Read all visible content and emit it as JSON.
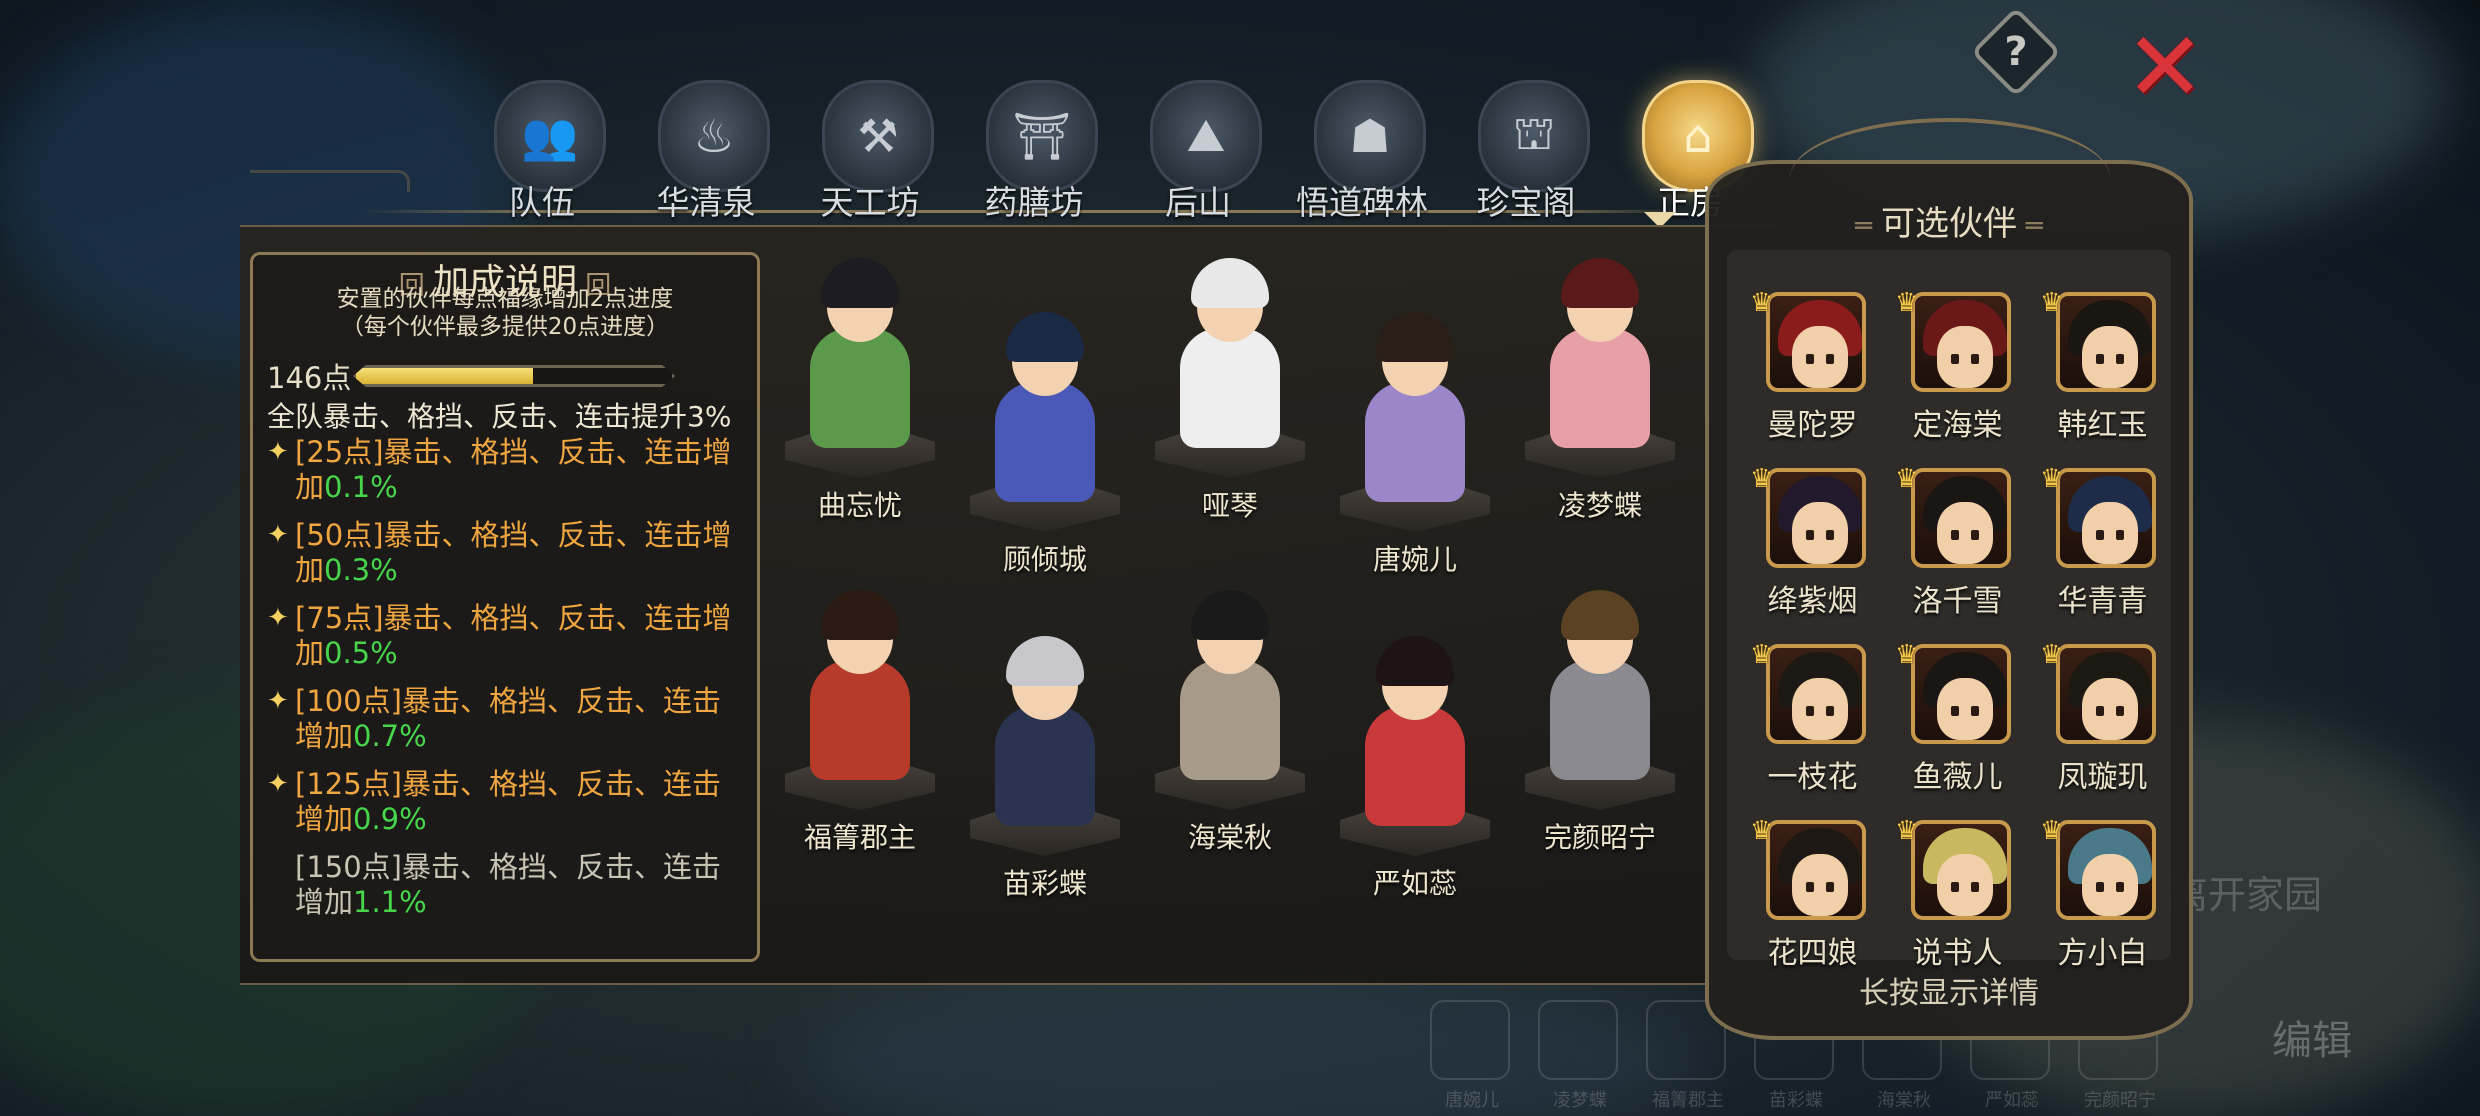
{
  "nav": {
    "tabs": [
      {
        "label": "队伍",
        "icon": "team-icon",
        "glyph": "👥",
        "active": false
      },
      {
        "label": "华清泉",
        "icon": "hot-spring-icon",
        "glyph": "♨",
        "active": false
      },
      {
        "label": "天工坊",
        "icon": "workshop-icon",
        "glyph": "⚒",
        "active": false
      },
      {
        "label": "药膳坊",
        "icon": "kitchen-icon",
        "glyph": "⛩",
        "active": false
      },
      {
        "label": "后山",
        "icon": "mountain-icon",
        "glyph": "⛰",
        "active": false
      },
      {
        "label": "悟道碑林",
        "icon": "stele-icon",
        "glyph": "☗",
        "active": false
      },
      {
        "label": "珍宝阁",
        "icon": "pagoda-icon",
        "glyph": "⛫",
        "active": false
      },
      {
        "label": "正房",
        "icon": "main-house-icon",
        "glyph": "⌂",
        "active": true
      }
    ]
  },
  "top_buttons": {
    "help_glyph": "?",
    "close_glyph": "✕"
  },
  "bonus": {
    "title": "加成说明",
    "desc_line1": "安置的伙伴每点福缘增加2点进度",
    "desc_line2": "（每个伙伴最多提供20点进度）",
    "points_label": "146点",
    "points_progress": 0.56,
    "team_bonus": "全队暴击、格挡、反击、连击提升3%",
    "tiers": [
      {
        "text": "[25点]暴击、格挡、反击、连击增加",
        "value": "0.1%",
        "reached": true
      },
      {
        "text": "[50点]暴击、格挡、反击、连击增加",
        "value": "0.3%",
        "reached": true
      },
      {
        "text": "[75点]暴击、格挡、反击、连击增加",
        "value": "0.5%",
        "reached": true
      },
      {
        "text": "[100点]暴击、格挡、反击、连击增加",
        "value": "0.7%",
        "reached": true
      },
      {
        "text": "[125点]暴击、格挡、反击、连击增加",
        "value": "0.9%",
        "reached": true
      },
      {
        "text": "[150点]暴击、格挡、反击、连击增加",
        "value": "1.1%",
        "reached": false
      }
    ]
  },
  "placed": [
    {
      "name": "曲忘忧",
      "hair": "#1c1c22",
      "robe": "#5a9a4a"
    },
    {
      "name": "顾倾城",
      "hair": "#1a2a44",
      "robe": "#4a58b8"
    },
    {
      "name": "哑琴",
      "hair": "#e8e8e8",
      "robe": "#eeeeee"
    },
    {
      "name": "唐婉儿",
      "hair": "#2a1e18",
      "robe": "#9a86c8"
    },
    {
      "name": "凌梦蝶",
      "hair": "#5a1a1a",
      "robe": "#e8a0a8"
    },
    {
      "name": "福箐郡主",
      "hair": "#2a1a12",
      "robe": "#b83a2a"
    },
    {
      "name": "苗彩蝶",
      "hair": "#c8c8cc",
      "robe": "#2a3450"
    },
    {
      "name": "海棠秋",
      "hair": "#1a1a1a",
      "robe": "#a89a88"
    },
    {
      "name": "严如蕊",
      "hair": "#1e1414",
      "robe": "#c83a3a"
    },
    {
      "name": "完颜昭宁",
      "hair": "#5a4222",
      "robe": "#8a8a90"
    }
  ],
  "companions": {
    "title": "可选伙伴",
    "hint": "长按显示详情",
    "items": [
      {
        "name": "曼陀罗",
        "hair": "#8a1c1c"
      },
      {
        "name": "定海棠",
        "hair": "#6a1818"
      },
      {
        "name": "韩红玉",
        "hair": "#1a1612"
      },
      {
        "name": "绛紫烟",
        "hair": "#221a2c"
      },
      {
        "name": "洛千雪",
        "hair": "#1a1614"
      },
      {
        "name": "华青青",
        "hair": "#1e2c4a"
      },
      {
        "name": "一枝花",
        "hair": "#1c1814"
      },
      {
        "name": "鱼薇儿",
        "hair": "#1a1614"
      },
      {
        "name": "凤璇玑",
        "hair": "#1c1812"
      },
      {
        "name": "花四娘",
        "hair": "#1e1814"
      },
      {
        "name": "说书人",
        "hair": "#c8b860"
      },
      {
        "name": "方小白",
        "hair": "#4a7a8a"
      }
    ]
  },
  "background": {
    "open_home": "离开家园",
    "edit": "编辑",
    "slots": [
      "唐婉儿",
      "凌梦蝶",
      "福箐郡主",
      "苗彩蝶",
      "海棠秋",
      "严如蕊",
      "完颜昭宁"
    ]
  }
}
